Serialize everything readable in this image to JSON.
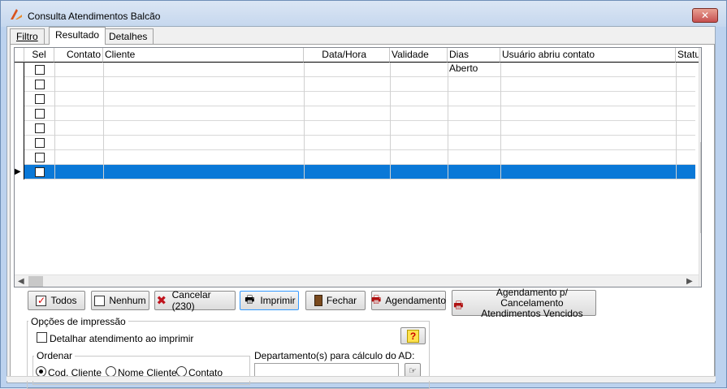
{
  "window": {
    "title": "Consulta Atendimentos Balcão",
    "close_glyph": "✕"
  },
  "tabs": [
    {
      "label": "Filtro"
    },
    {
      "label": "Resultado"
    },
    {
      "label": "Detalhes"
    }
  ],
  "grid": {
    "columns": [
      "Sel",
      "Contato",
      "Cliente",
      "Data/Hora",
      "Validade",
      "Dias Aberto",
      "Usuário abriu contato",
      "Statu"
    ],
    "row_count": 8,
    "selected_row": 7,
    "row_indicator_glyph": "▶"
  },
  "buttons": {
    "todos": "Todos",
    "nenhum": "Nenhum",
    "cancelar": "Cancelar (230)",
    "imprimir": "Imprimir",
    "fechar": "Fechar",
    "agendamento": "Agendamento",
    "agend_cancel_line1": "Agendamento p/ Cancelamento",
    "agend_cancel_line2": "Atendimentos Vencidos"
  },
  "print_options": {
    "group_label": "Opções de impressão",
    "detail_label": "Detalhar atendimento ao imprimir",
    "detail_checked": false,
    "help_glyph": "?"
  },
  "ordenar": {
    "label": "Ordenar",
    "options": [
      "Cod. Cliente",
      "Nome Cliente",
      "Contato"
    ],
    "selected": "Cod. Cliente"
  },
  "departamento": {
    "label": "Departamento(s) para cálculo do AD:",
    "value": ""
  },
  "colors": {
    "selection": "#0a78d7",
    "close_button": "#c75050"
  }
}
